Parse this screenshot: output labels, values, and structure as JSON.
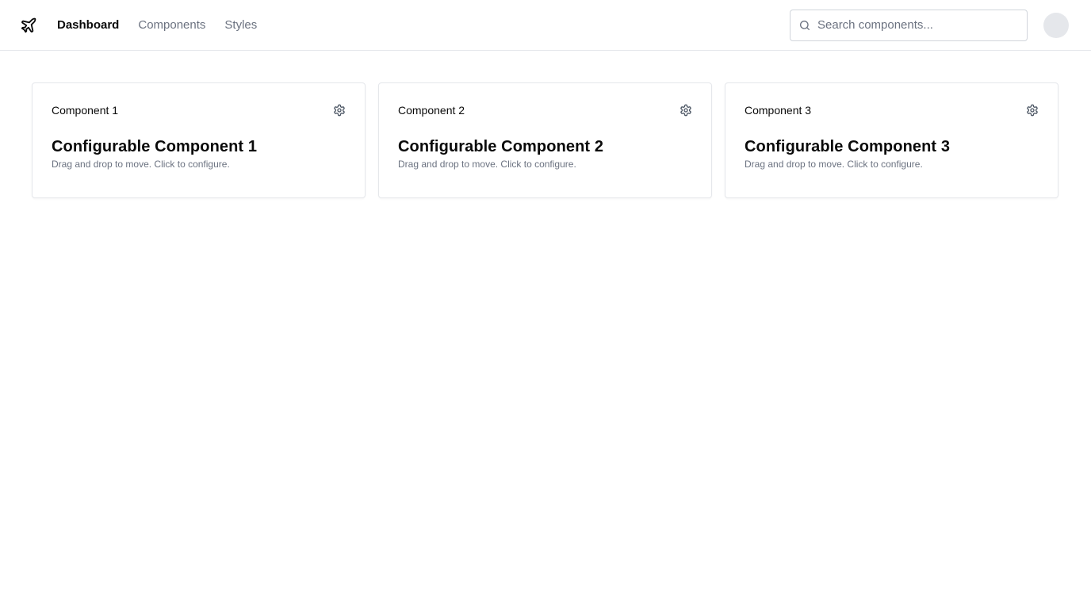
{
  "nav": {
    "logo_icon": "plane-icon",
    "links": [
      {
        "label": "Dashboard",
        "active": true
      },
      {
        "label": "Components",
        "active": false
      },
      {
        "label": "Styles",
        "active": false
      }
    ]
  },
  "search": {
    "placeholder": "Search components...",
    "value": ""
  },
  "cards": [
    {
      "label": "Component 1",
      "title": "Configurable Component 1",
      "description": "Drag and drop to move. Click to configure."
    },
    {
      "label": "Component 2",
      "title": "Configurable Component 2",
      "description": "Drag and drop to move. Click to configure."
    },
    {
      "label": "Component 3",
      "title": "Configurable Component 3",
      "description": "Drag and drop to move. Click to configure."
    }
  ],
  "colors": {
    "text": "#0a0a0a",
    "muted": "#6b7280",
    "border": "#e5e7eb"
  }
}
